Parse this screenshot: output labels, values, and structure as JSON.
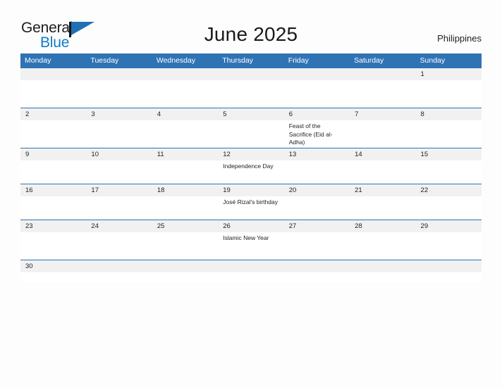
{
  "brand": {
    "word_one": "General",
    "word_two": "Blue",
    "flag_color": "#1f6fb4",
    "blue_text_color": "#0e7cc8"
  },
  "header": {
    "title": "June 2025",
    "country": "Philippines"
  },
  "theme": {
    "header_blue": "#3073b5",
    "rule_blue": "#2e72b2",
    "date_band_gray": "#f1f1f1",
    "page_background": "#fdfdfd"
  },
  "calendar": {
    "weekdays": [
      "Monday",
      "Tuesday",
      "Wednesday",
      "Thursday",
      "Friday",
      "Saturday",
      "Sunday"
    ],
    "weeks": [
      {
        "height_class": "row-h-tall",
        "days": [
          {
            "date": "",
            "event": ""
          },
          {
            "date": "",
            "event": ""
          },
          {
            "date": "",
            "event": ""
          },
          {
            "date": "",
            "event": ""
          },
          {
            "date": "",
            "event": ""
          },
          {
            "date": "",
            "event": ""
          },
          {
            "date": "1",
            "event": ""
          }
        ]
      },
      {
        "height_class": "row-h-tall",
        "days": [
          {
            "date": "2",
            "event": ""
          },
          {
            "date": "3",
            "event": ""
          },
          {
            "date": "4",
            "event": ""
          },
          {
            "date": "5",
            "event": ""
          },
          {
            "date": "6",
            "event": "Feast of the Sacrifice (Eid al-Adha)"
          },
          {
            "date": "7",
            "event": ""
          },
          {
            "date": "8",
            "event": ""
          }
        ]
      },
      {
        "height_class": "row-h-mid",
        "days": [
          {
            "date": "9",
            "event": ""
          },
          {
            "date": "10",
            "event": ""
          },
          {
            "date": "11",
            "event": ""
          },
          {
            "date": "12",
            "event": "Independence Day"
          },
          {
            "date": "13",
            "event": ""
          },
          {
            "date": "14",
            "event": ""
          },
          {
            "date": "15",
            "event": ""
          }
        ]
      },
      {
        "height_class": "row-h-mid",
        "days": [
          {
            "date": "16",
            "event": ""
          },
          {
            "date": "17",
            "event": ""
          },
          {
            "date": "18",
            "event": ""
          },
          {
            "date": "19",
            "event": "José Rizal's birthday"
          },
          {
            "date": "20",
            "event": ""
          },
          {
            "date": "21",
            "event": ""
          },
          {
            "date": "22",
            "event": ""
          }
        ]
      },
      {
        "height_class": "row-h-tall",
        "days": [
          {
            "date": "23",
            "event": ""
          },
          {
            "date": "24",
            "event": ""
          },
          {
            "date": "25",
            "event": ""
          },
          {
            "date": "26",
            "event": "Islamic New Year"
          },
          {
            "date": "27",
            "event": ""
          },
          {
            "date": "28",
            "event": ""
          },
          {
            "date": "29",
            "event": ""
          }
        ]
      },
      {
        "height_class": "row-h-last",
        "days": [
          {
            "date": "30",
            "event": ""
          },
          {
            "date": "",
            "event": ""
          },
          {
            "date": "",
            "event": ""
          },
          {
            "date": "",
            "event": ""
          },
          {
            "date": "",
            "event": ""
          },
          {
            "date": "",
            "event": ""
          },
          {
            "date": "",
            "event": ""
          }
        ]
      }
    ]
  }
}
